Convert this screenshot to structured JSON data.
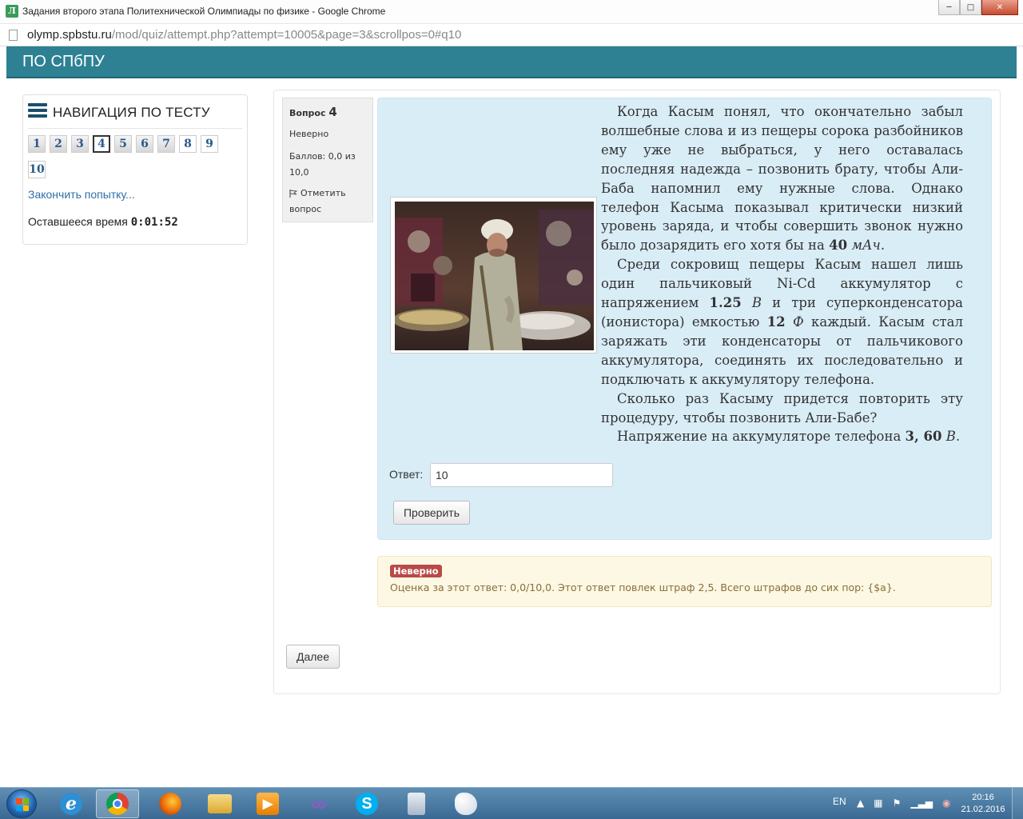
{
  "window": {
    "title": "Задания второго этапа Политехнической Олимпиады по физике - Google Chrome",
    "app_icon_letter": "Л",
    "controls": [
      "minimize",
      "maximize",
      "close"
    ]
  },
  "address": {
    "host": "olymp.spbstu.ru",
    "path": "/mod/quiz/attempt.php?attempt=10005&page=3&scrollpos=0#q10"
  },
  "site": {
    "brand": "ПО СПбПУ"
  },
  "nav": {
    "title": "НАВИГАЦИЯ ПО ТЕСТУ",
    "buttons": [
      "1",
      "2",
      "3",
      "4",
      "5",
      "6",
      "7",
      "8",
      "9",
      "10"
    ],
    "current": "4",
    "finish_link": "Закончить попытку...",
    "timer_label": "Оставшееся время",
    "timer_value": "0:01:52"
  },
  "question": {
    "label": "Вопрос",
    "number": "4",
    "state": "Неверно",
    "grade_line1": "Баллов: 0,0 из",
    "grade_line2": "10,0",
    "flag_line1": "Отметить",
    "flag_line2": "вопрос",
    "p1_a": "Когда Касым понял, что окончательно забыл волшебные слова и из пещеры сорока разбойников ему уже не выбраться, у него оставалась последняя надежда – позвонить брату, чтобы Али-Баба напомнил ему нужные слова. Однако телефон Касыма показывал критически низкий уровень заряда, и чтобы совершить звонок нужно было дозарядить его хотя бы на ",
    "p1_val": "40",
    "p1_unit": "мАч",
    "p1_end": ".",
    "p2_a": "Среди сокровищ пещеры Касым нашел лишь один пальчиковый Ni-Cd аккумулятор с напряжением ",
    "p2_val1": "1.25",
    "p2_unit1": "В",
    "p2_b": " и три суперконденсатора (ионистора) емкостью ",
    "p2_val2": "12",
    "p2_unit2": "Ф",
    "p2_c": " каждый. Касым стал заряжать эти конденсаторы от пальчикового аккумулятора, соединять их последовательно и подключать к аккумулятору телефона.",
    "p3": "Сколько раз Касыму придется повторить эту процедуру, чтобы позвонить Али-Бабе?",
    "p4_a": "Напряжение на аккумуляторе телефона ",
    "p4_val": "3, 60",
    "p4_unit": "В",
    "p4_end": ".",
    "answer_label": "Ответ:",
    "answer_value": "10",
    "check_button": "Проверить"
  },
  "feedback": {
    "badge": "Неверно",
    "text": "Оценка за этот ответ: 0,0/10,0. Этот ответ повлек штраф 2,5. Всего штрафов до сих пор: {$a}."
  },
  "next_button": "Далее",
  "taskbar": {
    "apps": [
      "internet-explorer",
      "chrome",
      "firefox",
      "file-explorer",
      "media-player",
      "visual-studio",
      "skype",
      "calculator",
      "paint"
    ],
    "lang": "EN",
    "time": "20:16",
    "date": "21.02.2016"
  },
  "colors": {
    "header": "#2d8193",
    "question_bg": "#d9edf7",
    "feedback_bg": "#fcf8e3",
    "badge": "#b94a48"
  }
}
